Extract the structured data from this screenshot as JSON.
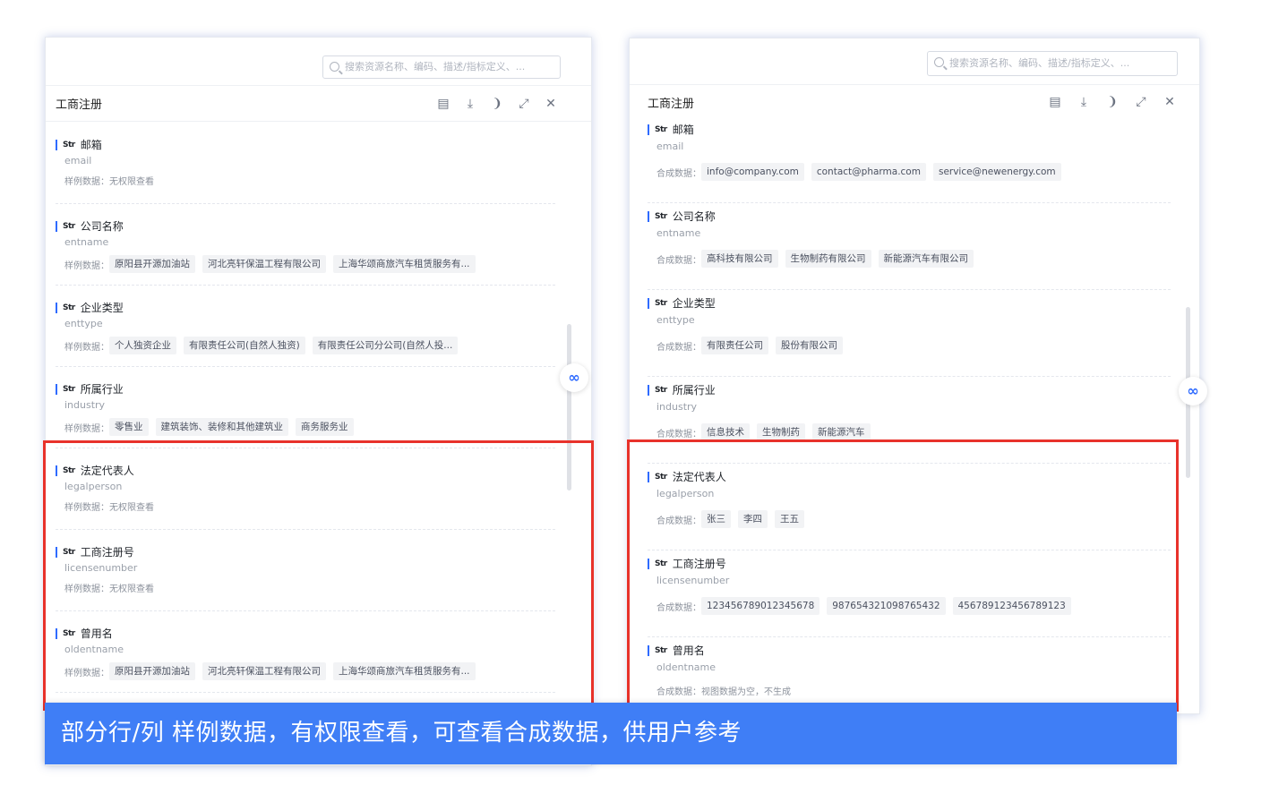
{
  "left_panel": {
    "search_placeholder": "搜索资源名称、编码、描述/指标定义、...",
    "title": "工商注册",
    "tool_icons": [
      "table-icon",
      "download-icon",
      "quote-icon",
      "expand-icon",
      "close-icon"
    ],
    "type_label": "Str",
    "fields": [
      {
        "name": "邮箱",
        "code": "email",
        "sample_label": "样例数据：",
        "samples": [
          "无权限查看"
        ],
        "plain": true
      },
      {
        "name": "公司名称",
        "code": "entname",
        "sample_label": "样例数据：",
        "samples": [
          "原阳县开源加油站",
          "河北亮轩保温工程有限公司",
          "上海华颂商旅汽车租赁服务有..."
        ]
      },
      {
        "name": "企业类型",
        "code": "enttype",
        "sample_label": "样例数据：",
        "samples": [
          "个人独资企业",
          "有限责任公司(自然人独资)",
          "有限责任公司分公司(自然人投..."
        ]
      },
      {
        "name": "所属行业",
        "code": "industry",
        "sample_label": "样例数据：",
        "samples": [
          "零售业",
          "建筑装饰、装修和其他建筑业",
          "商务服务业"
        ]
      },
      {
        "name": "法定代表人",
        "code": "legalperson",
        "sample_label": "样例数据：",
        "samples": [
          "无权限查看"
        ],
        "plain": true
      },
      {
        "name": "工商注册号",
        "code": "licensenumber",
        "sample_label": "样例数据：",
        "samples": [
          "无权限查看"
        ],
        "plain": true
      },
      {
        "name": "曾用名",
        "code": "oldentname",
        "sample_label": "样例数据：",
        "samples": [
          "原阳县开源加油站",
          "河北亮轩保温工程有限公司",
          "上海华颂商旅汽车租赁服务有..."
        ]
      }
    ]
  },
  "right_panel": {
    "search_placeholder": "搜索资源名称、编码、描述/指标定义、...",
    "title": "工商注册",
    "type_label": "Str",
    "fields": [
      {
        "name": "邮箱",
        "code": "email",
        "sample_label": "合成数据：",
        "samples": [
          "info@company.com",
          "contact@pharma.com",
          "service@newenergy.com"
        ]
      },
      {
        "name": "公司名称",
        "code": "entname",
        "sample_label": "合成数据：",
        "samples": [
          "高科技有限公司",
          "生物制药有限公司",
          "新能源汽车有限公司"
        ]
      },
      {
        "name": "企业类型",
        "code": "enttype",
        "sample_label": "合成数据：",
        "samples": [
          "有限责任公司",
          "股份有限公司"
        ]
      },
      {
        "name": "所属行业",
        "code": "industry",
        "sample_label": "合成数据：",
        "samples": [
          "信息技术",
          "生物制药",
          "新能源汽车"
        ]
      },
      {
        "name": "法定代表人",
        "code": "legalperson",
        "sample_label": "合成数据：",
        "samples": [
          "张三",
          "李四",
          "王五"
        ]
      },
      {
        "name": "工商注册号",
        "code": "licensenumber",
        "sample_label": "合成数据：",
        "samples": [
          "123456789012345678",
          "987654321098765432",
          "456789123456789123"
        ]
      },
      {
        "name": "曾用名",
        "code": "oldentname",
        "sample_label": "合成数据：",
        "samples": [
          "视图数据为空，不生成"
        ],
        "plain": true
      }
    ]
  },
  "banner_text": "部分行/列 样例数据，有权限查看，可查看合成数据，供用户参考",
  "colors": {
    "accent": "#2f6bff",
    "highlight": "#e8322b",
    "banner": "#3f7ef6"
  }
}
